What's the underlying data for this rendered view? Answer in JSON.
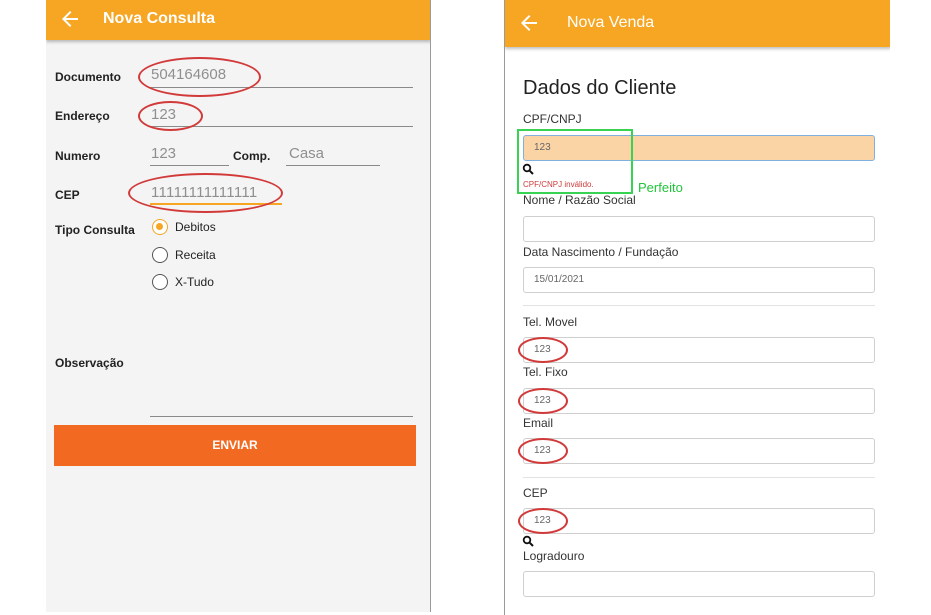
{
  "left": {
    "title": "Nova Consulta",
    "fields": {
      "documento": {
        "label": "Documento",
        "value": "504164608"
      },
      "endereco": {
        "label": "Endereço",
        "value": "123"
      },
      "numero": {
        "label": "Numero",
        "value": "123"
      },
      "comp": {
        "label": "Comp.",
        "value": "Casa"
      },
      "cep": {
        "label": "CEP",
        "value": "11111111111111"
      },
      "tipo": {
        "label": "Tipo Consulta"
      },
      "observacao": {
        "label": "Observação",
        "value": ""
      }
    },
    "radios": [
      {
        "label": "Debitos",
        "selected": true
      },
      {
        "label": "Receita",
        "selected": false
      },
      {
        "label": "X-Tudo",
        "selected": false
      }
    ],
    "submit_label": "ENVIAR"
  },
  "right": {
    "title": "Nova Venda",
    "section_title": "Dados do Cliente",
    "cpf": {
      "label": "CPF/CNPJ",
      "value": "123",
      "error": "CPF/CNPJ inválido."
    },
    "nome": {
      "label": "Nome / Razão Social",
      "value": ""
    },
    "nascimento": {
      "label": "Data Nascimento / Fundação",
      "value": "15/01/2021"
    },
    "tel_movel": {
      "label": "Tel. Movel",
      "value": "123"
    },
    "tel_fixo": {
      "label": "Tel. Fixo",
      "value": "123"
    },
    "email": {
      "label": "Email",
      "value": "123"
    },
    "cep": {
      "label": "CEP",
      "value": "123"
    },
    "logradouro": {
      "label": "Logradouro",
      "value": ""
    }
  },
  "annotation": {
    "text": "Perfeito"
  },
  "colors": {
    "appbar": "#f6a623",
    "button": "#f26a21",
    "error_circle": "#d23a3a",
    "ok_box": "#39d353"
  }
}
